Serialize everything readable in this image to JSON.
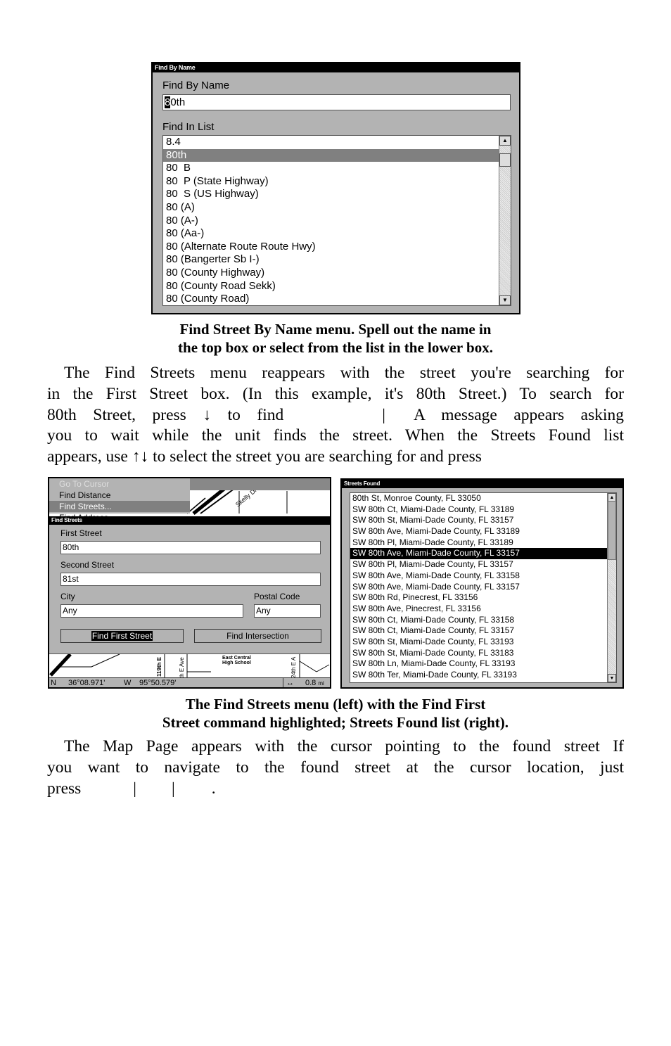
{
  "find_by_name_window": {
    "title": "Find By Name",
    "name_label": "Find By Name",
    "name_value_cursor": "8",
    "name_value_rest": "0th",
    "list_label": "Find In List",
    "list_items": [
      "8.4",
      "80th",
      "80  B",
      "80  P (State Highway)",
      "80  S (US Highway)",
      "80 (A)",
      "80 (A-)",
      "80 (Aa-)",
      "80 (Alternate Route Route Hwy)",
      "80 (Bangerter Sb I-)",
      "80 (County Highway)",
      "80 (County Road Sekk)",
      "80 (County Road)"
    ],
    "selected_index": 1,
    "scroll_up_icon": "arrow-up-icon",
    "scroll_down_icon": "arrow-down-icon"
  },
  "caption1": {
    "line1": "Find Street By Name menu. Spell out the name in",
    "line2": "the top box or select from the list in the lower box."
  },
  "para1": {
    "line1": "The Find Streets menu reappears with the street you're searching for",
    "line2": "in the First Street box. (In this example, it's 80th Street.) To search for",
    "line3a": "80th Street, press ↓ to find",
    "line3b": "|",
    "line3c": "A message appears asking",
    "line4": "you to wait while the unit finds the street. When the Streets Found list",
    "line5": "appears, use ↑↓ to select the street you are searching for and press"
  },
  "find_streets_screen": {
    "menu_items": [
      "Go To Cursor",
      "Find Distance",
      "Find Streets...",
      "Find Address"
    ],
    "selected_menu_index": 2,
    "map_label_top": "Skelly Dr",
    "title": "Find Streets",
    "first_street_label": "First Street",
    "first_street_value": "80th",
    "second_street_label": "Second Street",
    "second_street_value": "81st",
    "city_label": "City",
    "city_value": "Any",
    "postal_label": "Postal Code",
    "postal_value": "Any",
    "find_first_button": "Find First Street",
    "find_intersection_button": "Find Intersection",
    "map_labels": [
      "119th E",
      "th E Ave",
      "East Central",
      "High School",
      "24th E A"
    ],
    "status": {
      "lat_hemi": "N",
      "lat": "36°08.971'",
      "lon_hemi": "W",
      "lon": "95°50.579'",
      "zoom_icon": "horizontal-arrows-icon",
      "scale": "0.8",
      "scale_unit": "mi"
    }
  },
  "streets_found_window": {
    "title": "Streets Found",
    "items": [
      "80th St, Monroe County, FL 33050",
      "SW 80th Ct, Miami-Dade County, FL 33189",
      "SW 80th St, Miami-Dade County, FL 33157",
      "SW 80th Ave, Miami-Dade County, FL 33189",
      "SW 80th Pl, Miami-Dade County, FL 33189",
      "SW 80th Ave, Miami-Dade County, FL 33157",
      "SW 80th Pl, Miami-Dade County, FL 33157",
      "SW 80th Ave, Miami-Dade County, FL 33158",
      "SW 80th Ave, Miami-Dade County, FL 33157",
      "SW 80th Rd, Pinecrest, FL 33156",
      "SW 80th Ave, Pinecrest, FL 33156",
      "SW 80th Ct, Miami-Dade County, FL 33158",
      "SW 80th Ct, Miami-Dade County, FL 33157",
      "SW 80th St, Miami-Dade County, FL 33193",
      "SW 80th St, Miami-Dade County, FL 33183",
      "SW 80th Ln, Miami-Dade County, FL 33193",
      "SW 80th Ter, Miami-Dade County, FL 33193"
    ],
    "selected_index": 5
  },
  "caption2": {
    "line1": "The Find Streets menu (left) with the Find First",
    "line2": "Street command highlighted; Streets Found list (right)."
  },
  "para2": {
    "line1": "The Map Page appears with the cursor pointing to the found street  If",
    "line2": "you want to navigate to the found street at the cursor location, just",
    "line3a": "press",
    "line3b": "|",
    "line3c": "|",
    "line3d": "."
  }
}
